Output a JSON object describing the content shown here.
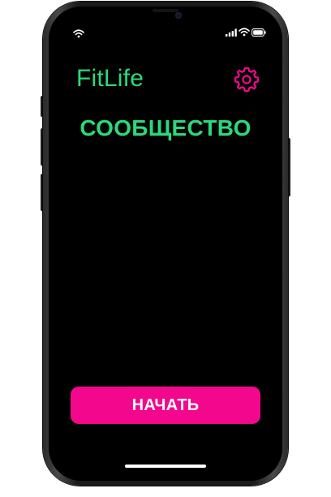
{
  "app": {
    "title": "FitLife"
  },
  "main": {
    "section_title": "СООБЩЕСТВО",
    "start_button_label": "НАЧАТЬ"
  },
  "header": {
    "settings_icon": "gear-icon"
  },
  "status_bar": {
    "icons": [
      "wifi-icon",
      "signal-icon",
      "wifi-icon",
      "battery-icon"
    ]
  },
  "colors": {
    "background": "#000000",
    "title_green": "#2bd97a",
    "accent_pink": "#f3078c",
    "button_text": "#ffffff"
  }
}
